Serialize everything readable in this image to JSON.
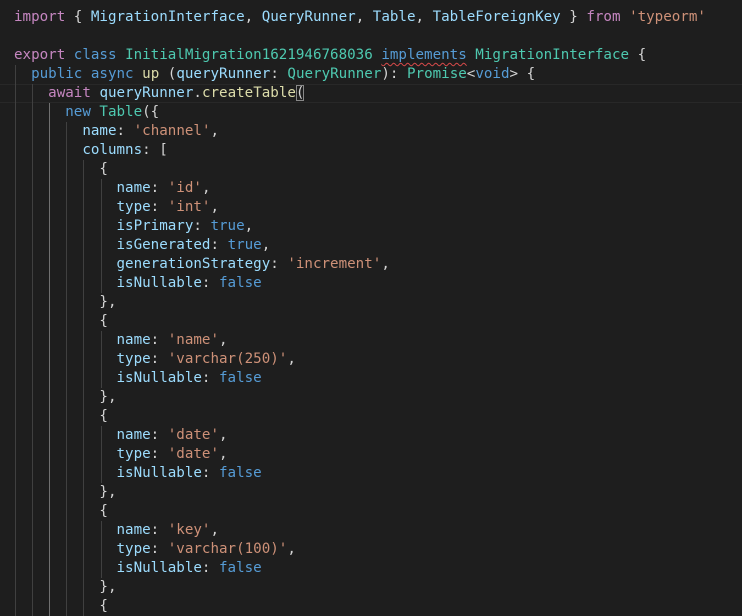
{
  "editor": {
    "lines": [
      [
        [
          "kw",
          "import"
        ],
        [
          "pu",
          " { "
        ],
        [
          "va",
          "MigrationInterface"
        ],
        [
          "pu",
          ", "
        ],
        [
          "va",
          "QueryRunner"
        ],
        [
          "pu",
          ", "
        ],
        [
          "va",
          "Table"
        ],
        [
          "pu",
          ", "
        ],
        [
          "va",
          "TableForeignKey"
        ],
        [
          "pu",
          " } "
        ],
        [
          "kw",
          "from"
        ],
        [
          "pu",
          " "
        ],
        [
          "st",
          "'typeorm'"
        ]
      ],
      [],
      [
        [
          "kw",
          "export"
        ],
        [
          "pu",
          " "
        ],
        [
          "kb",
          "class"
        ],
        [
          "pu",
          " "
        ],
        [
          "ty",
          "InitialMigration1621946768036"
        ],
        [
          "pu",
          " "
        ],
        [
          "kb",
          "implements",
          "squiggle"
        ],
        [
          "pu",
          " "
        ],
        [
          "ty",
          "MigrationInterface"
        ],
        [
          "pu",
          " {"
        ]
      ],
      [
        [
          "pu",
          "  "
        ],
        [
          "kb",
          "public"
        ],
        [
          "pu",
          " "
        ],
        [
          "kb",
          "async"
        ],
        [
          "pu",
          " "
        ],
        [
          "fn",
          "up"
        ],
        [
          "pu",
          " ("
        ],
        [
          "va",
          "queryRunner"
        ],
        [
          "pu",
          ": "
        ],
        [
          "ty",
          "QueryRunner"
        ],
        [
          "pu",
          "): "
        ],
        [
          "ty",
          "Promise"
        ],
        [
          "pu",
          "<"
        ],
        [
          "kb",
          "void"
        ],
        [
          "pu",
          "> {"
        ]
      ],
      [
        [
          "pu",
          "    "
        ],
        [
          "kw",
          "await"
        ],
        [
          "pu",
          " "
        ],
        [
          "va",
          "queryRunner"
        ],
        [
          "pu",
          "."
        ],
        [
          "fn",
          "createTable"
        ],
        [
          "pu",
          "(",
          "bracket"
        ]
      ],
      [
        [
          "pu",
          "      "
        ],
        [
          "kb",
          "new"
        ],
        [
          "pu",
          " "
        ],
        [
          "ty",
          "Table"
        ],
        [
          "pu",
          "({"
        ]
      ],
      [
        [
          "pu",
          "        "
        ],
        [
          "va",
          "name"
        ],
        [
          "pu",
          ": "
        ],
        [
          "st",
          "'channel'"
        ],
        [
          "pu",
          ","
        ]
      ],
      [
        [
          "pu",
          "        "
        ],
        [
          "va",
          "columns"
        ],
        [
          "pu",
          ": ["
        ]
      ],
      [
        [
          "pu",
          "          {"
        ]
      ],
      [
        [
          "pu",
          "            "
        ],
        [
          "va",
          "name"
        ],
        [
          "pu",
          ": "
        ],
        [
          "st",
          "'id'"
        ],
        [
          "pu",
          ","
        ]
      ],
      [
        [
          "pu",
          "            "
        ],
        [
          "va",
          "type"
        ],
        [
          "pu",
          ": "
        ],
        [
          "st",
          "'int'"
        ],
        [
          "pu",
          ","
        ]
      ],
      [
        [
          "pu",
          "            "
        ],
        [
          "va",
          "isPrimary"
        ],
        [
          "pu",
          ": "
        ],
        [
          "kb",
          "true"
        ],
        [
          "pu",
          ","
        ]
      ],
      [
        [
          "pu",
          "            "
        ],
        [
          "va",
          "isGenerated"
        ],
        [
          "pu",
          ": "
        ],
        [
          "kb",
          "true"
        ],
        [
          "pu",
          ","
        ]
      ],
      [
        [
          "pu",
          "            "
        ],
        [
          "va",
          "generationStrategy"
        ],
        [
          "pu",
          ": "
        ],
        [
          "st",
          "'increment'"
        ],
        [
          "pu",
          ","
        ]
      ],
      [
        [
          "pu",
          "            "
        ],
        [
          "va",
          "isNullable"
        ],
        [
          "pu",
          ": "
        ],
        [
          "kb",
          "false"
        ]
      ],
      [
        [
          "pu",
          "          },"
        ]
      ],
      [
        [
          "pu",
          "          {"
        ]
      ],
      [
        [
          "pu",
          "            "
        ],
        [
          "va",
          "name"
        ],
        [
          "pu",
          ": "
        ],
        [
          "st",
          "'name'"
        ],
        [
          "pu",
          ","
        ]
      ],
      [
        [
          "pu",
          "            "
        ],
        [
          "va",
          "type"
        ],
        [
          "pu",
          ": "
        ],
        [
          "st",
          "'varchar(250)'"
        ],
        [
          "pu",
          ","
        ]
      ],
      [
        [
          "pu",
          "            "
        ],
        [
          "va",
          "isNullable"
        ],
        [
          "pu",
          ": "
        ],
        [
          "kb",
          "false"
        ]
      ],
      [
        [
          "pu",
          "          },"
        ]
      ],
      [
        [
          "pu",
          "          {"
        ]
      ],
      [
        [
          "pu",
          "            "
        ],
        [
          "va",
          "name"
        ],
        [
          "pu",
          ": "
        ],
        [
          "st",
          "'date'"
        ],
        [
          "pu",
          ","
        ]
      ],
      [
        [
          "pu",
          "            "
        ],
        [
          "va",
          "type"
        ],
        [
          "pu",
          ": "
        ],
        [
          "st",
          "'date'"
        ],
        [
          "pu",
          ","
        ]
      ],
      [
        [
          "pu",
          "            "
        ],
        [
          "va",
          "isNullable"
        ],
        [
          "pu",
          ": "
        ],
        [
          "kb",
          "false"
        ]
      ],
      [
        [
          "pu",
          "          },"
        ]
      ],
      [
        [
          "pu",
          "          {"
        ]
      ],
      [
        [
          "pu",
          "            "
        ],
        [
          "va",
          "name"
        ],
        [
          "pu",
          ": "
        ],
        [
          "st",
          "'key'"
        ],
        [
          "pu",
          ","
        ]
      ],
      [
        [
          "pu",
          "            "
        ],
        [
          "va",
          "type"
        ],
        [
          "pu",
          ": "
        ],
        [
          "st",
          "'varchar(100)'"
        ],
        [
          "pu",
          ","
        ]
      ],
      [
        [
          "pu",
          "            "
        ],
        [
          "va",
          "isNullable"
        ],
        [
          "pu",
          ": "
        ],
        [
          "kb",
          "false"
        ]
      ],
      [
        [
          "pu",
          "          },"
        ]
      ],
      [
        [
          "pu",
          "          {"
        ]
      ]
    ],
    "colors": {
      "background": "#1e1e1e",
      "keyword_control": "#c586c0",
      "keyword": "#569cd6",
      "type": "#4ec9b0",
      "function": "#dcdcaa",
      "variable": "#9cdcfe",
      "string": "#ce9178",
      "punctuation": "#d4d4d4"
    }
  }
}
